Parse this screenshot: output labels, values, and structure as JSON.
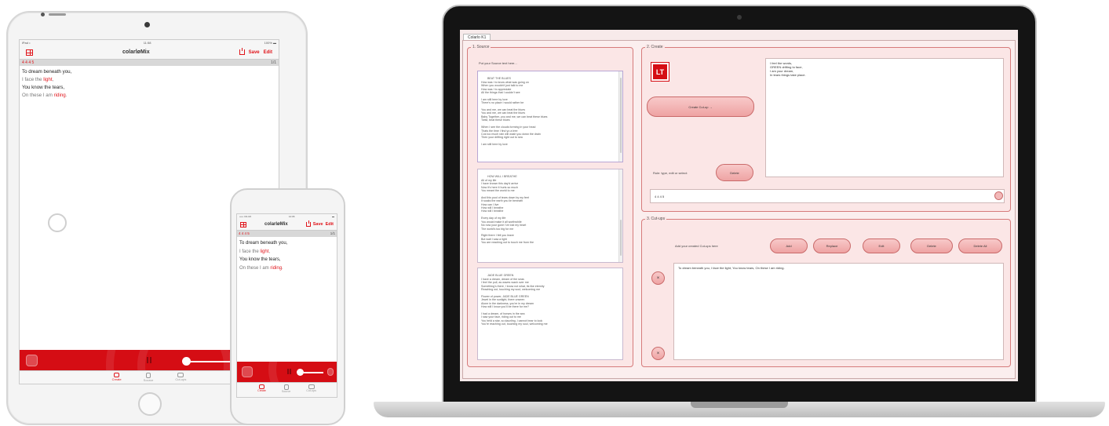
{
  "app": {
    "title": "colarløMix",
    "save": "Save",
    "edit": "Edit",
    "rule": "4 4 4 5",
    "count": "1/1"
  },
  "ipad": {
    "status_left": "iPad •",
    "status_center": "11:58",
    "status_right": "100% ▬",
    "poem": [
      {
        "parts": [
          {
            "text": "To dream beneath you,",
            "style": "blk"
          }
        ]
      },
      {
        "parts": [
          {
            "text": "I face the ",
            "style": "grey"
          },
          {
            "text": "light",
            "style": "red"
          },
          {
            "text": ",",
            "style": "grey"
          }
        ]
      },
      {
        "parts": [
          {
            "text": "You know the tears,",
            "style": "blk"
          }
        ]
      },
      {
        "parts": [
          {
            "text": "On these I am ",
            "style": "grey"
          },
          {
            "text": "riding",
            "style": "red"
          },
          {
            "text": ".",
            "style": "grey"
          }
        ]
      }
    ],
    "tabs": [
      "Create",
      "Source",
      "Cut-ups"
    ]
  },
  "iphone": {
    "status_left": "••••• O2-UK",
    "status_center": "14:06",
    "status_right": "▬",
    "poem": [
      {
        "parts": [
          {
            "text": "To dream beneath you,",
            "style": "blk"
          }
        ]
      },
      {
        "parts": [
          {
            "text": "I face the ",
            "style": "grey"
          },
          {
            "text": "light",
            "style": "red"
          },
          {
            "text": ",",
            "style": "grey"
          }
        ]
      },
      {
        "parts": [
          {
            "text": "You know the tears,",
            "style": "blk"
          }
        ]
      },
      {
        "parts": [
          {
            "text": "On these I am ",
            "style": "grey"
          },
          {
            "text": "riding",
            "style": "red"
          },
          {
            "text": ".",
            "style": "grey"
          }
        ]
      }
    ],
    "tabs": [
      "Create",
      "Source",
      "Cut-ups"
    ]
  },
  "desktop": {
    "window_tab": "Colarlo K1",
    "source": {
      "label": "1. Source",
      "prompt": "Put your Source text here...",
      "text1": "BEAT THE BLUES\nHow was I to know what was going on\nWhen you wouldn't just talk to me\nHow was I to appreciate\nAll the things that I couldn't see\n\nI am still here by love\nThere's no place I would rather be\n\nYou and me, we can beat the blues\nYou and me, we can beat the blues\nBaby Together, you and me, we can beat these blues\nTwist, beat these blues\n\nWhen I see the clouds forming in your head\nThats the time I find yo a tree\nCos too much rain will wash you down the drain\nThen your drifting right out to sea\n\nI am still here by love",
      "text2": "HOW WILL I BREATHE\nAll of my life\nI have known this day'd arrive\nNow it's here it hurts so much\nYou meant the world to me\n\nAnd this pool of tears down by my feet\nIt soaks the earth you lie beneath\nHow can I live\nHow will I breathe\nHow will I breathe\n\nEvery day of my life\nYou would make it all worthwhile\nNo now your gone I've lost my heart\nThe world's too big for me\n\nRight there I felt you leave\nBut wait I saw a light\nYou are reaching out to touch me from the",
      "text3": "JADE BLUE GREEN\nI have a dream, dream of the seas\nI feel the pull, as waves wash over me\nSomething's there, I know not what, its like eternity\nReaching out, touching my soul, welcoming me\n\nFlower of power, JADE BLUE GREEN\nJewel in the sunlight, there unseen\nAlone in the darkness, you're in my dream\nHow will I know you'll be there for me?\n\nI had a dream, of horses in the sea\nI saw your face, riding out to me\nYou held a star, so dazzling, I cannot bear to look\nYou're reaching out, touching my soul, welcoming me"
    },
    "create": {
      "label": "2. Create",
      "logo": "LT",
      "create_button": "Create Cut-up →",
      "output": "I feel the words,\nGREEN drifting to face,\nI am your dream,\nIn tears things take place.",
      "rule_label": "Rule: type, edit or select:",
      "delete": "Delete",
      "rule_value": "4 4 4 5"
    },
    "cutups": {
      "label": "3. Cut-ups",
      "prompt": "Add your created Cut-ups here",
      "buttons": [
        "Add",
        "Replace",
        "Edit",
        "Delete",
        "Delete All"
      ],
      "content": "To dream beneath you, I face the light, You know tears, On these I am riding."
    }
  },
  "colors": {
    "accent": "#e0141a",
    "player": "#d50d14",
    "panel": "#fbe6e6"
  }
}
